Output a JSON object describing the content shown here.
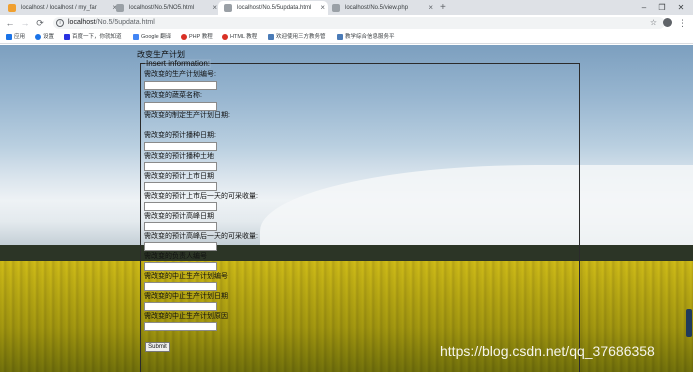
{
  "browser": {
    "tabs": [
      {
        "title": "localhost / localhost / my_far",
        "active": false,
        "favicon": "phpmyadmin-icon"
      },
      {
        "title": "localhost/No.5/NO5.html",
        "active": false,
        "favicon": "page-icon"
      },
      {
        "title": "localhost/No.5/5updata.html",
        "active": true,
        "favicon": "page-icon"
      },
      {
        "title": "localhost/No.5/view.php",
        "active": false,
        "favicon": "page-icon"
      }
    ],
    "new_tab_label": "+",
    "close_glyph": "×",
    "window_controls": {
      "minimize": "–",
      "maximize": "❐",
      "close": "✕"
    },
    "url_host": "localhost",
    "url_path": "/No.5/5updata.html",
    "bookmarks": [
      {
        "label": "应用",
        "icon_color": "#1a73e8"
      },
      {
        "label": "设置",
        "icon_color": "#1a73e8"
      },
      {
        "label": "百度一下，你就知道",
        "icon_color": "#2932e1"
      },
      {
        "label": "Google 翻译",
        "icon_color": "#4285f4"
      },
      {
        "label": "PHP 教程",
        "icon_color": "#d93025"
      },
      {
        "label": "HTML 教程",
        "icon_color": "#d93025"
      },
      {
        "label": "欢迎使用三方教务管",
        "icon_color": "#4a7bb7"
      },
      {
        "label": "教学综合信息服务平",
        "icon_color": "#4a7bb7"
      }
    ]
  },
  "page": {
    "title": "改变生产计划",
    "legend": "Insert information:",
    "fields": [
      {
        "label": "需改变的生产计划编号:",
        "value": ""
      },
      {
        "label": "需改变的蔬菜名称:",
        "value": ""
      },
      {
        "label": "需改变的制定生产计划日期:",
        "value": ""
      },
      {
        "label": "需改变的预计播种日期:",
        "value": ""
      },
      {
        "label": "需改变的预计播种土地",
        "value": ""
      },
      {
        "label": "需改变的预计上市日期",
        "value": ""
      },
      {
        "label": "需改变的预计上市后一天的可采收量:",
        "value": ""
      },
      {
        "label": "需改变的预计高峰日期",
        "value": ""
      },
      {
        "label": "需改变的预计高峰后一天的可采收量:",
        "value": ""
      },
      {
        "label": "需改变的负责人编号",
        "value": ""
      },
      {
        "label": "需改变的中止生产计划编号",
        "value": ""
      },
      {
        "label": "需改变的中止生产计划日期",
        "value": ""
      },
      {
        "label": "需改变的中止生产计划原因",
        "value": ""
      }
    ],
    "submit_label": "Submit",
    "watermark": "https://blog.csdn.net/qq_37686358"
  },
  "colors": {
    "tabstrip": "#dee1e6",
    "sky_top": "#7c9fbf",
    "field": "#d2c316"
  }
}
